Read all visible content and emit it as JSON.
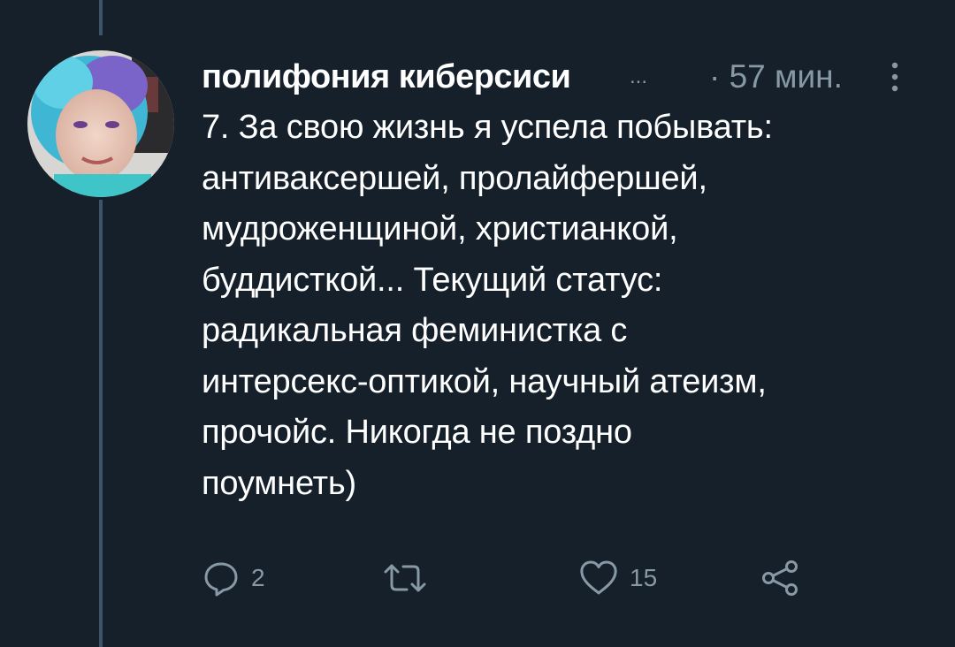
{
  "tweet": {
    "display_name": "полифония киберсиси",
    "name_ellipsis": "...",
    "timestamp": "· 57 мин.",
    "text": "7. За свою жизнь я успела побывать:\nантиваксершей, пролайфершей,\nмудроженщиной, христианкой,\nбуддисткой... Текущий статус:\nрадикальная феминистка с\nинтерсекс-оптикой, научный атеизм,\nпрочойс. Никогда не поздно\nпоумнеть)",
    "reply_count": "2",
    "retweet_count": "",
    "like_count": "15"
  },
  "icons": {
    "more": "more-vertical-icon",
    "reply": "reply-bubble-icon",
    "retweet": "retweet-icon",
    "like": "heart-icon",
    "share": "share-icon"
  },
  "colors": {
    "background": "#15202b",
    "text_primary": "#ffffff",
    "text_secondary": "#8899a6",
    "thread_line": "#3d5466"
  }
}
